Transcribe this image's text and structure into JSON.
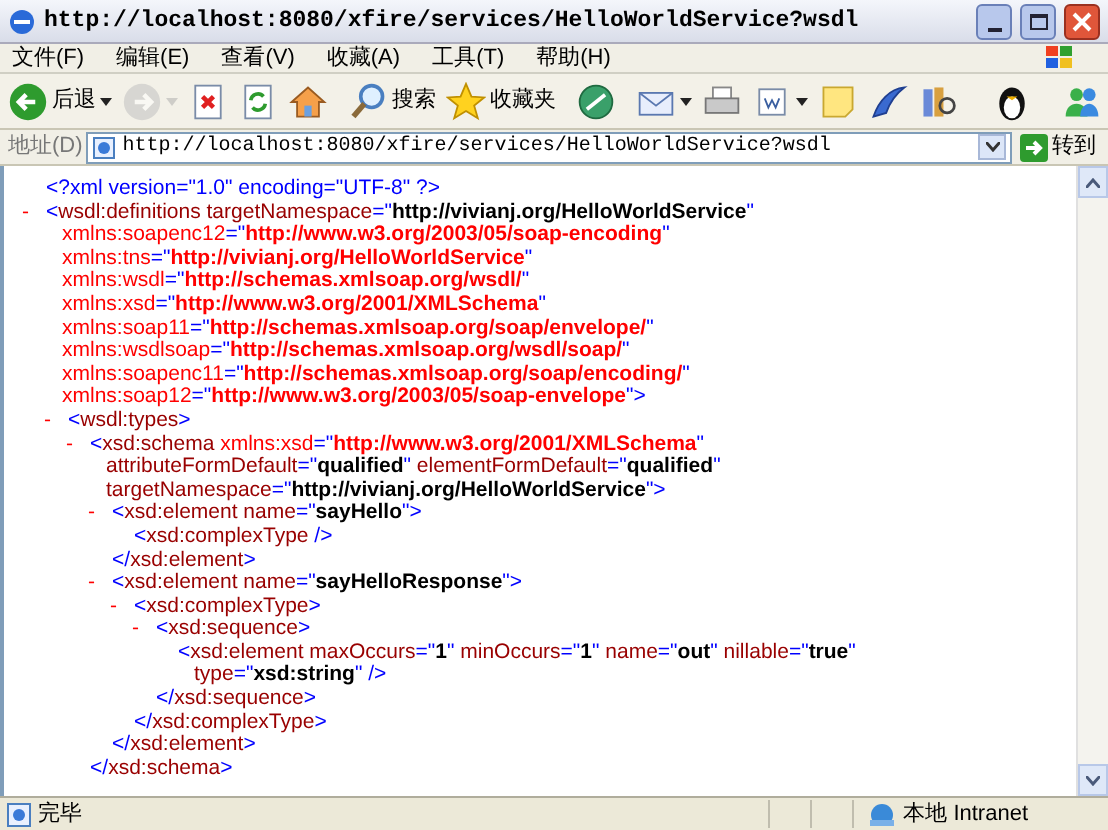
{
  "window": {
    "title": "http://localhost:8080/xfire/services/HelloWorldService?wsdl"
  },
  "menu": [
    "文件(F)",
    "编辑(E)",
    "查看(V)",
    "收藏(A)",
    "工具(T)",
    "帮助(H)"
  ],
  "toolbar": [
    {
      "kind": "back",
      "label": "后退",
      "disabled": false,
      "has_menu": true
    },
    {
      "kind": "forward",
      "disabled": true,
      "has_menu": true
    },
    {
      "kind": "stop",
      "disabled": false,
      "has_menu": false
    },
    {
      "kind": "refresh",
      "disabled": false,
      "has_menu": false
    },
    {
      "kind": "home",
      "disabled": false,
      "has_menu": false
    },
    {
      "kind": "search",
      "label": "搜索",
      "disabled": false,
      "has_menu": false
    },
    {
      "kind": "favorites",
      "label": "收藏夹",
      "disabled": false,
      "has_menu": false
    },
    {
      "kind": "media",
      "disabled": false,
      "has_menu": false
    },
    {
      "kind": "mail",
      "disabled": false,
      "has_menu": true
    },
    {
      "kind": "print",
      "disabled": false,
      "has_menu": false
    },
    {
      "kind": "edit",
      "disabled": false,
      "has_menu": true
    },
    {
      "kind": "note",
      "disabled": false,
      "has_menu": false
    },
    {
      "kind": "feather",
      "disabled": false,
      "has_menu": false
    },
    {
      "kind": "research",
      "disabled": false,
      "has_menu": false
    },
    {
      "kind": "penguin",
      "disabled": false,
      "has_menu": false
    },
    {
      "kind": "messenger",
      "disabled": false,
      "has_menu": false
    }
  ],
  "address": {
    "label": "地址(D)",
    "value": "http://localhost:8080/xfire/services/HelloWorldService?wsdl",
    "go": "转到"
  },
  "document": [
    {
      "lines": [
        [
          {
            "kind": "markup",
            "text": "<?xml version=\"1.0\" encoding=\"UTF-8\" ?>"
          }
        ]
      ]
    },
    {
      "toggle": "-",
      "lines": [
        [
          {
            "kind": "markup",
            "text": "<"
          },
          {
            "kind": "name",
            "text": "wsdl:definitions targetNamespace"
          },
          {
            "kind": "markup",
            "text": "=\""
          },
          {
            "kind": "value",
            "text": "http://vivianj.org/HelloWorldService"
          },
          {
            "kind": "markup",
            "text": "\""
          }
        ],
        [
          {
            "kind": "xmlns",
            "text": "xmlns:soapenc12"
          },
          {
            "kind": "markup",
            "text": "=\""
          },
          {
            "kind": "xmlns_value",
            "text": "http://www.w3.org/2003/05/soap-encoding"
          },
          {
            "kind": "markup",
            "text": "\""
          }
        ],
        [
          {
            "kind": "xmlns",
            "text": "xmlns:tns"
          },
          {
            "kind": "markup",
            "text": "=\""
          },
          {
            "kind": "xmlns_value",
            "text": "http://vivianj.org/HelloWorldService"
          },
          {
            "kind": "markup",
            "text": "\""
          }
        ],
        [
          {
            "kind": "xmlns",
            "text": "xmlns:wsdl"
          },
          {
            "kind": "markup",
            "text": "=\""
          },
          {
            "kind": "xmlns_value",
            "text": "http://schemas.xmlsoap.org/wsdl/"
          },
          {
            "kind": "markup",
            "text": "\""
          }
        ],
        [
          {
            "kind": "xmlns",
            "text": "xmlns:xsd"
          },
          {
            "kind": "markup",
            "text": "=\""
          },
          {
            "kind": "xmlns_value",
            "text": "http://www.w3.org/2001/XMLSchema"
          },
          {
            "kind": "markup",
            "text": "\""
          }
        ],
        [
          {
            "kind": "xmlns",
            "text": "xmlns:soap11"
          },
          {
            "kind": "markup",
            "text": "=\""
          },
          {
            "kind": "xmlns_value",
            "text": "http://schemas.xmlsoap.org/soap/envelope/"
          },
          {
            "kind": "markup",
            "text": "\""
          }
        ],
        [
          {
            "kind": "xmlns",
            "text": "xmlns:wsdlsoap"
          },
          {
            "kind": "markup",
            "text": "=\""
          },
          {
            "kind": "xmlns_value",
            "text": "http://schemas.xmlsoap.org/wsdl/soap/"
          },
          {
            "kind": "markup",
            "text": "\""
          }
        ],
        [
          {
            "kind": "xmlns",
            "text": "xmlns:soapenc11"
          },
          {
            "kind": "markup",
            "text": "=\""
          },
          {
            "kind": "xmlns_value",
            "text": "http://schemas.xmlsoap.org/soap/encoding/"
          },
          {
            "kind": "markup",
            "text": "\""
          }
        ],
        [
          {
            "kind": "xmlns",
            "text": "xmlns:soap12"
          },
          {
            "kind": "markup",
            "text": "=\""
          },
          {
            "kind": "xmlns_value",
            "text": "http://www.w3.org/2003/05/soap-envelope"
          },
          {
            "kind": "markup",
            "text": "\">"
          }
        ]
      ],
      "children": [
        {
          "toggle": "-",
          "lines": [
            [
              {
                "kind": "markup",
                "text": "<"
              },
              {
                "kind": "name",
                "text": "wsdl:types"
              },
              {
                "kind": "markup",
                "text": ">"
              }
            ]
          ],
          "children": [
            {
              "toggle": "-",
              "lines": [
                [
                  {
                    "kind": "markup",
                    "text": "<"
                  },
                  {
                    "kind": "name",
                    "text": "xsd:schema"
                  },
                  {
                    "kind": "xmlns",
                    "text": " xmlns:xsd"
                  },
                  {
                    "kind": "markup",
                    "text": "=\""
                  },
                  {
                    "kind": "xmlns_value",
                    "text": "http://www.w3.org/2001/XMLSchema"
                  },
                  {
                    "kind": "markup",
                    "text": "\""
                  }
                ],
                [
                  {
                    "kind": "name",
                    "text": "attributeFormDefault"
                  },
                  {
                    "kind": "markup",
                    "text": "=\""
                  },
                  {
                    "kind": "value",
                    "text": "qualified"
                  },
                  {
                    "kind": "markup",
                    "text": "\""
                  },
                  {
                    "kind": "name",
                    "text": " elementFormDefault"
                  },
                  {
                    "kind": "markup",
                    "text": "=\""
                  },
                  {
                    "kind": "value",
                    "text": "qualified"
                  },
                  {
                    "kind": "markup",
                    "text": "\""
                  }
                ],
                [
                  {
                    "kind": "name",
                    "text": "targetNamespace"
                  },
                  {
                    "kind": "markup",
                    "text": "=\""
                  },
                  {
                    "kind": "value",
                    "text": "http://vivianj.org/HelloWorldService"
                  },
                  {
                    "kind": "markup",
                    "text": "\">"
                  }
                ]
              ],
              "children": [
                {
                  "toggle": "-",
                  "lines": [
                    [
                      {
                        "kind": "markup",
                        "text": "<"
                      },
                      {
                        "kind": "name",
                        "text": "xsd:element name"
                      },
                      {
                        "kind": "markup",
                        "text": "=\""
                      },
                      {
                        "kind": "value",
                        "text": "sayHello"
                      },
                      {
                        "kind": "markup",
                        "text": "\">"
                      }
                    ]
                  ],
                  "children": [
                    {
                      "lines": [
                        [
                          {
                            "kind": "markup",
                            "text": "<"
                          },
                          {
                            "kind": "name",
                            "text": "xsd:complexType"
                          },
                          {
                            "kind": "markup",
                            "text": " />"
                          }
                        ]
                      ]
                    }
                  ],
                  "closing": [
                    {
                      "kind": "markup",
                      "text": "</"
                    },
                    {
                      "kind": "name",
                      "text": "xsd:element"
                    },
                    {
                      "kind": "markup",
                      "text": ">"
                    }
                  ]
                },
                {
                  "toggle": "-",
                  "lines": [
                    [
                      {
                        "kind": "markup",
                        "text": "<"
                      },
                      {
                        "kind": "name",
                        "text": "xsd:element name"
                      },
                      {
                        "kind": "markup",
                        "text": "=\""
                      },
                      {
                        "kind": "value",
                        "text": "sayHelloResponse"
                      },
                      {
                        "kind": "markup",
                        "text": "\">"
                      }
                    ]
                  ],
                  "children": [
                    {
                      "toggle": "-",
                      "lines": [
                        [
                          {
                            "kind": "markup",
                            "text": "<"
                          },
                          {
                            "kind": "name",
                            "text": "xsd:complexType"
                          },
                          {
                            "kind": "markup",
                            "text": ">"
                          }
                        ]
                      ],
                      "children": [
                        {
                          "toggle": "-",
                          "lines": [
                            [
                              {
                                "kind": "markup",
                                "text": "<"
                              },
                              {
                                "kind": "name",
                                "text": "xsd:sequence"
                              },
                              {
                                "kind": "markup",
                                "text": ">"
                              }
                            ]
                          ],
                          "children": [
                            {
                              "lines": [
                                [
                                  {
                                    "kind": "markup",
                                    "text": "<"
                                  },
                                  {
                                    "kind": "name",
                                    "text": "xsd:element maxOccurs"
                                  },
                                  {
                                    "kind": "markup",
                                    "text": "=\""
                                  },
                                  {
                                    "kind": "value",
                                    "text": "1"
                                  },
                                  {
                                    "kind": "markup",
                                    "text": "\""
                                  },
                                  {
                                    "kind": "name",
                                    "text": " minOccurs"
                                  },
                                  {
                                    "kind": "markup",
                                    "text": "=\""
                                  },
                                  {
                                    "kind": "value",
                                    "text": "1"
                                  },
                                  {
                                    "kind": "markup",
                                    "text": "\""
                                  },
                                  {
                                    "kind": "name",
                                    "text": " name"
                                  },
                                  {
                                    "kind": "markup",
                                    "text": "=\""
                                  },
                                  {
                                    "kind": "value",
                                    "text": "out"
                                  },
                                  {
                                    "kind": "markup",
                                    "text": "\""
                                  },
                                  {
                                    "kind": "name",
                                    "text": " nillable"
                                  },
                                  {
                                    "kind": "markup",
                                    "text": "=\""
                                  },
                                  {
                                    "kind": "value",
                                    "text": "true"
                                  },
                                  {
                                    "kind": "markup",
                                    "text": "\""
                                  }
                                ],
                                [
                                  {
                                    "kind": "name",
                                    "text": "type"
                                  },
                                  {
                                    "kind": "markup",
                                    "text": "=\""
                                  },
                                  {
                                    "kind": "value",
                                    "text": "xsd:string"
                                  },
                                  {
                                    "kind": "markup",
                                    "text": "\" />"
                                  }
                                ]
                              ]
                            }
                          ],
                          "closing": [
                            {
                              "kind": "markup",
                              "text": "</"
                            },
                            {
                              "kind": "name",
                              "text": "xsd:sequence"
                            },
                            {
                              "kind": "markup",
                              "text": ">"
                            }
                          ]
                        }
                      ],
                      "closing": [
                        {
                          "kind": "markup",
                          "text": "</"
                        },
                        {
                          "kind": "name",
                          "text": "xsd:complexType"
                        },
                        {
                          "kind": "markup",
                          "text": ">"
                        }
                      ]
                    }
                  ],
                  "closing": [
                    {
                      "kind": "markup",
                      "text": "</"
                    },
                    {
                      "kind": "name",
                      "text": "xsd:element"
                    },
                    {
                      "kind": "markup",
                      "text": ">"
                    }
                  ]
                }
              ],
              "closing": [
                {
                  "kind": "markup",
                  "text": "</"
                },
                {
                  "kind": "name",
                  "text": "xsd:schema"
                },
                {
                  "kind": "markup",
                  "text": ">"
                }
              ]
            }
          ]
        }
      ]
    }
  ],
  "status_bar": {
    "text": "完毕",
    "zone": "本地 Intranet"
  }
}
